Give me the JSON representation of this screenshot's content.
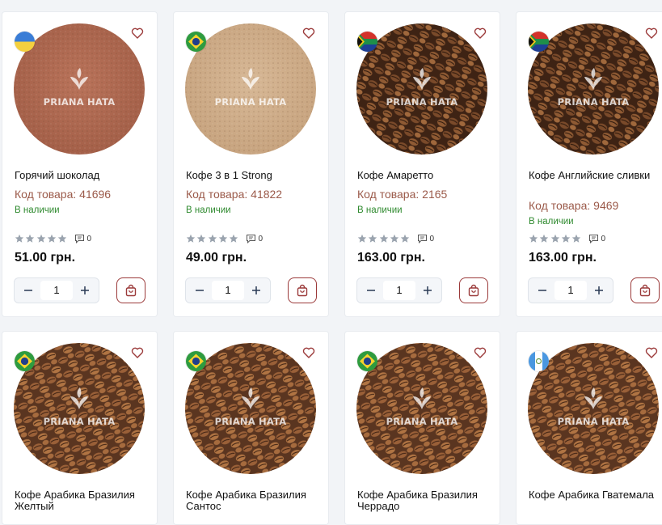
{
  "watermark_text": "PRIANA HATA",
  "colors": {
    "accent": "#9b3a3a",
    "code_text": "#9b5a4a",
    "in_stock": "#2f8a2f",
    "star_empty": "#9aa3ae"
  },
  "products": [
    {
      "title": "Горячий шоколад",
      "code": "Код товара: 41696",
      "stock": "В наличии",
      "comments": "0",
      "price": "51.00 грн.",
      "qty": "1",
      "flag": "ukraine-flag-icon",
      "image": "cocoa-powder"
    },
    {
      "title": "Кофе 3 в 1 Strong",
      "code": "Код товара: 41822",
      "stock": "В наличии",
      "comments": "0",
      "price": "49.00 грн.",
      "qty": "1",
      "flag": "brazil-flag-icon",
      "image": "instant-powder"
    },
    {
      "title": "Кофе Амаретто",
      "code": "Код товара: 2165",
      "stock": "В наличии",
      "comments": "0",
      "price": "163.00 грн.",
      "qty": "1",
      "flag": "south-africa-flag-icon",
      "image": "dark-beans"
    },
    {
      "title": "Кофе Английские сливки",
      "code": "Код товара: 9469",
      "stock": "В наличии",
      "comments": "0",
      "price": "163.00 грн.",
      "qty": "1",
      "flag": "south-africa-flag-icon",
      "image": "dark-beans"
    },
    {
      "title": "Кофе Арабика Бразилия Желтый",
      "flag": "brazil-flag-icon",
      "image": "medium-beans"
    },
    {
      "title": "Кофе Арабика Бразилия Сантос",
      "flag": "brazil-flag-icon",
      "image": "medium-beans"
    },
    {
      "title": "Кофе Арабика Бразилия Черрадо",
      "flag": "brazil-flag-icon",
      "image": "medium-beans"
    },
    {
      "title": "Кофе Арабика Гватемала",
      "flag": "guatemala-flag-icon",
      "image": "medium-beans"
    }
  ]
}
